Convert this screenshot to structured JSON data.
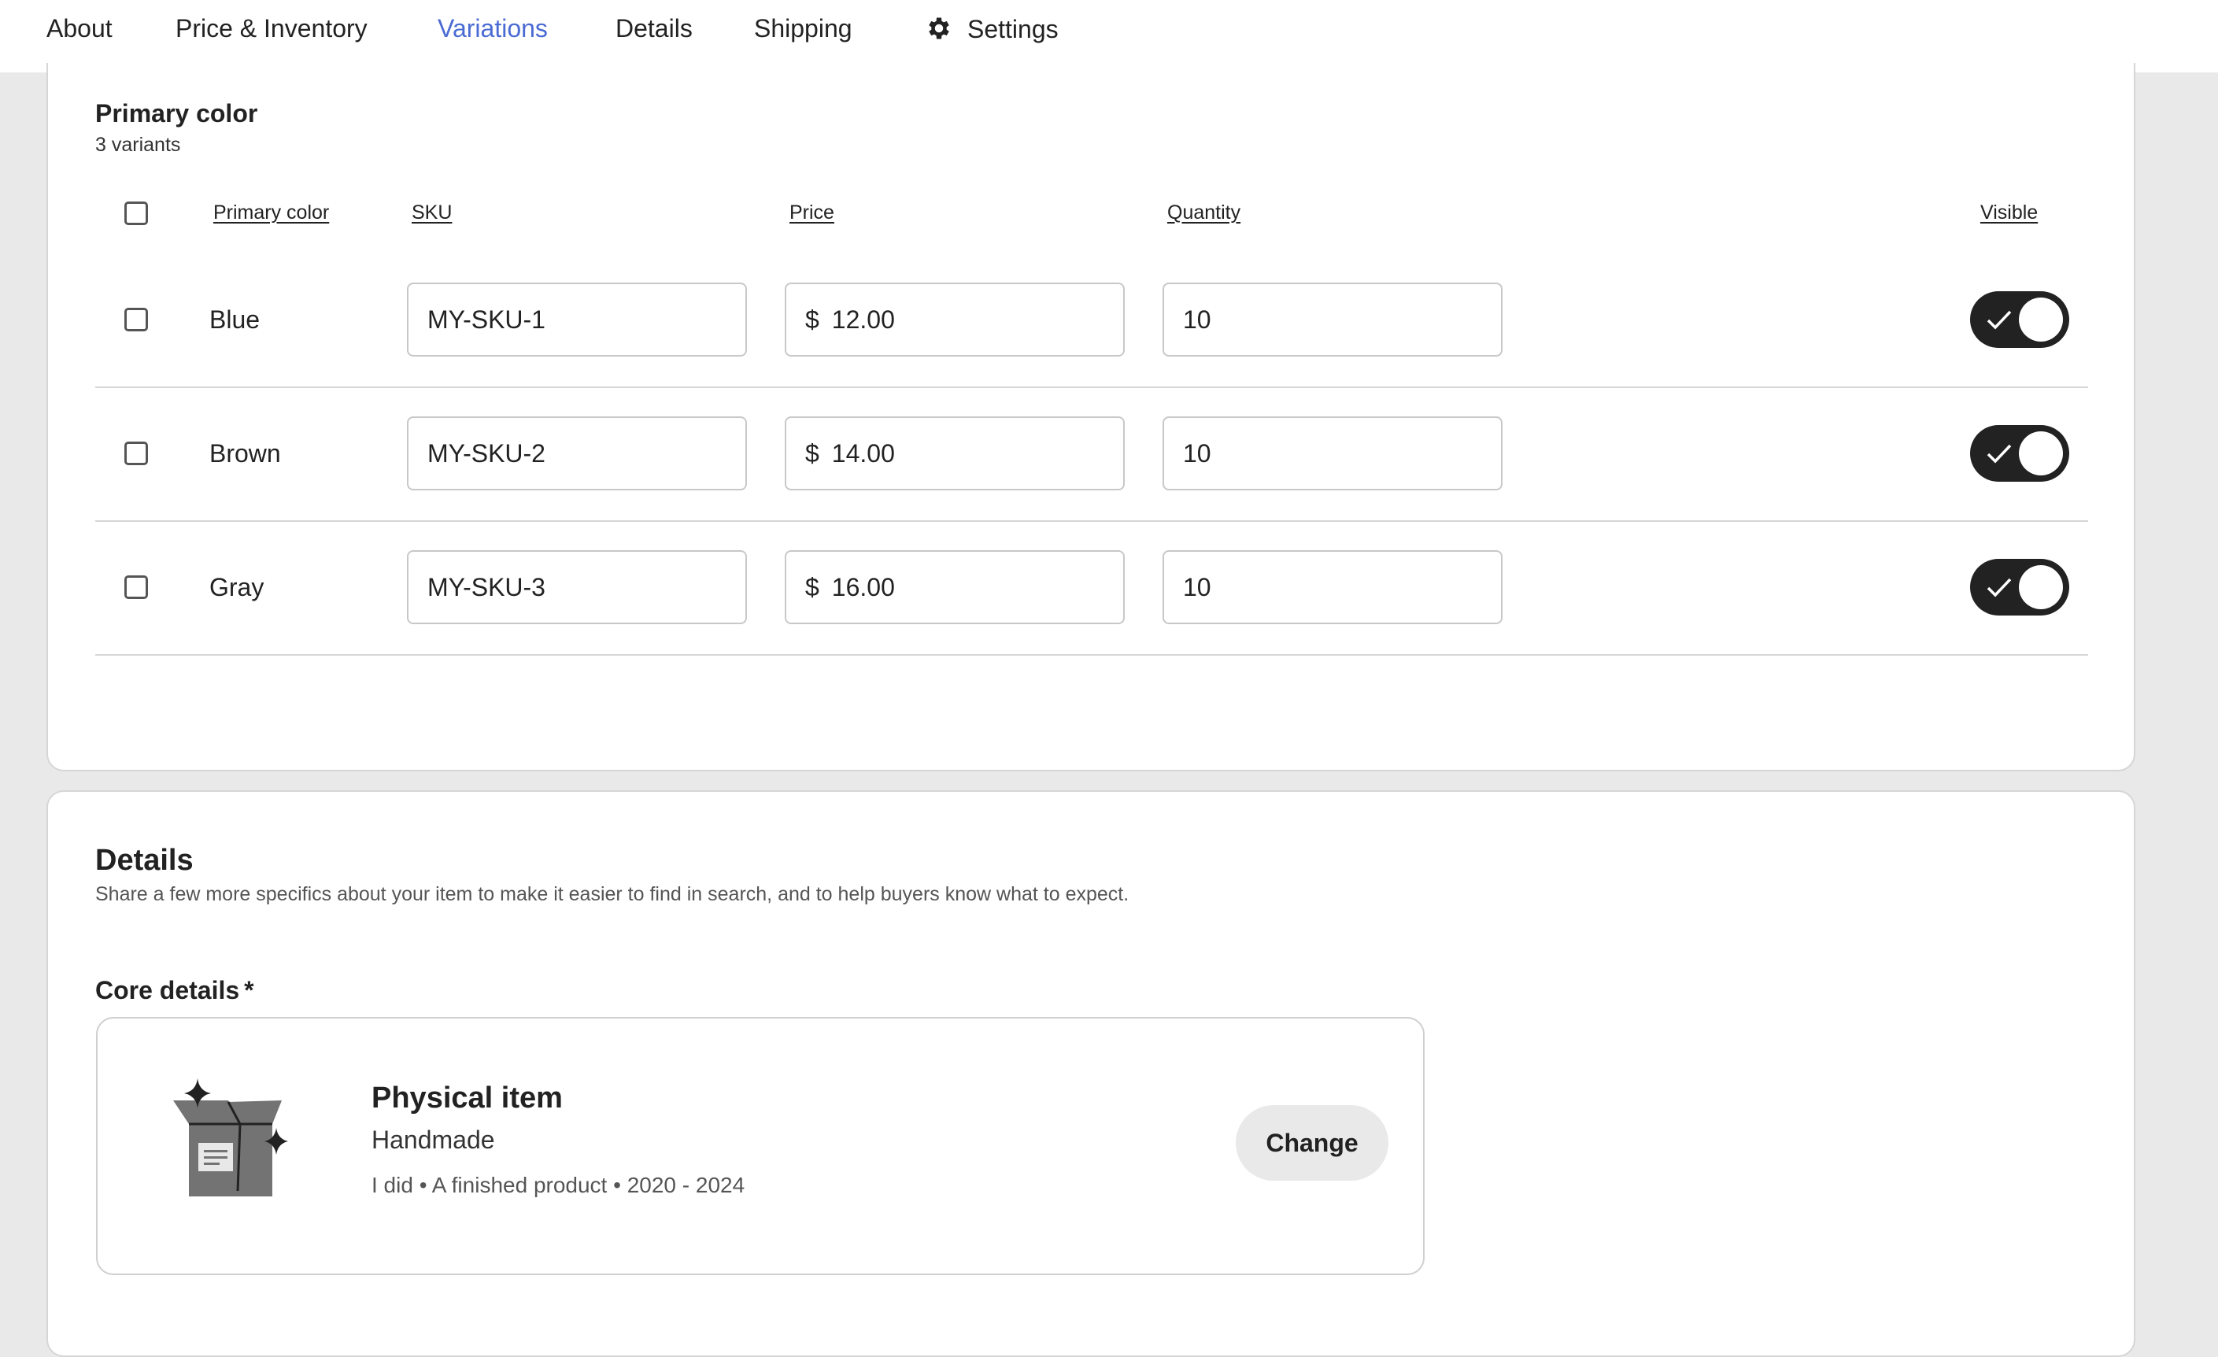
{
  "tabs": [
    {
      "label": "About",
      "active": false
    },
    {
      "label": "Price & Inventory",
      "active": false
    },
    {
      "label": "Variations",
      "active": true
    },
    {
      "label": "Details",
      "active": false
    },
    {
      "label": "Shipping",
      "active": false
    },
    {
      "label": "Settings",
      "active": false,
      "icon": "gear-icon"
    }
  ],
  "colors": {
    "accent": "#4a6ad4",
    "toggle_on": "#222222",
    "page_bg": "#e9e9e9"
  },
  "variations": {
    "title": "Primary color",
    "subtitle": "3 variants",
    "columns": {
      "primary_color": "Primary color",
      "sku": "SKU",
      "price": "Price",
      "quantity": "Quantity",
      "visible": "Visible"
    },
    "currency_symbol": "$",
    "rows": [
      {
        "color": "Blue",
        "sku": "MY-SKU-1",
        "price": "12.00",
        "quantity": "10",
        "visible": true,
        "selected": false
      },
      {
        "color": "Brown",
        "sku": "MY-SKU-2",
        "price": "14.00",
        "quantity": "10",
        "visible": true,
        "selected": false
      },
      {
        "color": "Gray",
        "sku": "MY-SKU-3",
        "price": "16.00",
        "quantity": "10",
        "visible": true,
        "selected": false
      }
    ]
  },
  "details": {
    "title": "Details",
    "description": "Share a few more specifics about your item to make it easier to find in search, and to help buyers know what to expect.",
    "core_label": "Core details",
    "required_mark": "*",
    "core": {
      "icon": "box-icon",
      "title": "Physical item",
      "subtitle": "Handmade",
      "meta": "I did • A finished product • 2020 - 2024",
      "change_label": "Change"
    }
  }
}
